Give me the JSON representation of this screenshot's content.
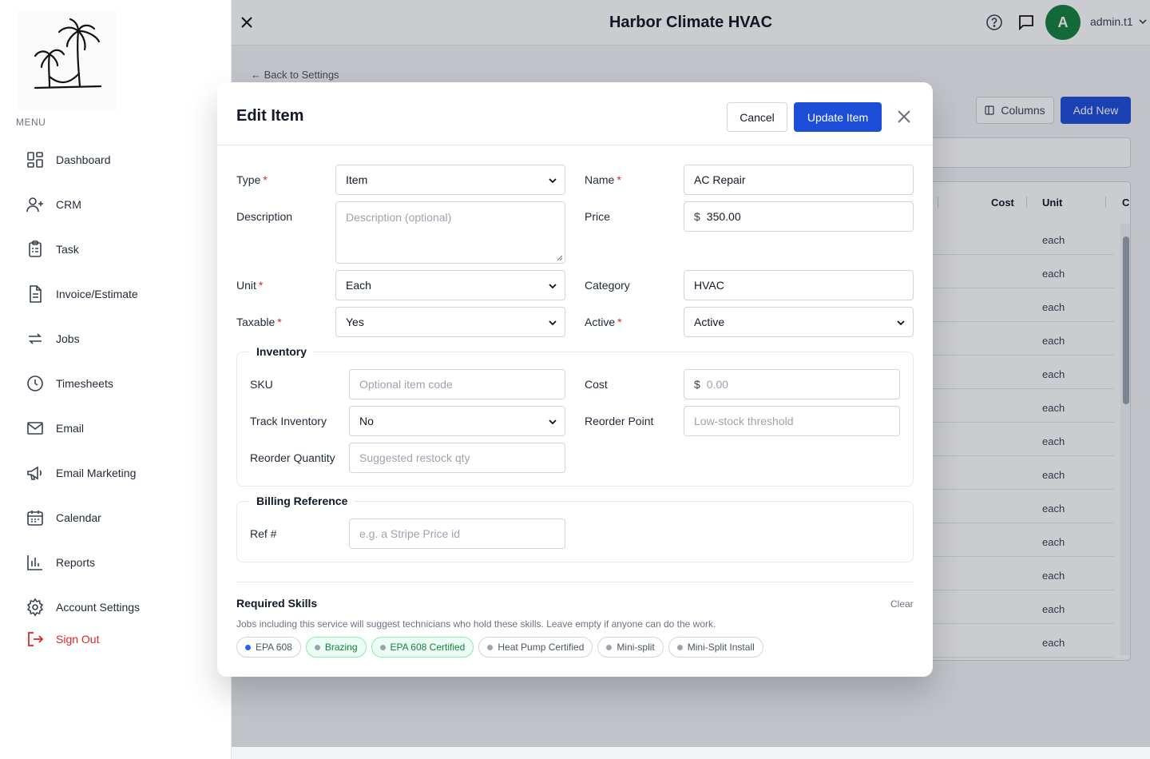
{
  "sidebar": {
    "menu_label": "MENU",
    "items": [
      {
        "label": "Dashboard",
        "icon": "dashboard-icon"
      },
      {
        "label": "CRM",
        "icon": "user-plus-icon"
      },
      {
        "label": "Task",
        "icon": "clipboard-icon"
      },
      {
        "label": "Invoice/Estimate",
        "icon": "document-icon"
      },
      {
        "label": "Jobs",
        "icon": "repeat-icon"
      },
      {
        "label": "Timesheets",
        "icon": "clock-icon"
      },
      {
        "label": "Email",
        "icon": "mail-icon"
      },
      {
        "label": "Email Marketing",
        "icon": "megaphone-icon"
      },
      {
        "label": "Calendar",
        "icon": "calendar-icon"
      },
      {
        "label": "Reports",
        "icon": "bar-chart-icon"
      },
      {
        "label": "Account Settings",
        "icon": "gear-icon"
      }
    ],
    "sign_out": "Sign Out"
  },
  "header": {
    "title": "Harbor Climate HVAC",
    "avatar_initial": "A",
    "user_name": "admin.t1"
  },
  "page": {
    "back_link": "← Back to Settings",
    "columns_button": "Columns",
    "add_new_button": "Add New",
    "table_headers": [
      "Cost",
      "Unit",
      "C"
    ],
    "unit_values": [
      "each",
      "each",
      "each",
      "each",
      "each",
      "each",
      "each",
      "each",
      "each",
      "each",
      "each",
      "each",
      "each"
    ]
  },
  "modal": {
    "title": "Edit Item",
    "cancel": "Cancel",
    "update": "Update Item",
    "fields": {
      "type": {
        "label": "Type",
        "value": "Item"
      },
      "name": {
        "label": "Name",
        "value": "AC Repair"
      },
      "description": {
        "label": "Description",
        "placeholder": "Description (optional)"
      },
      "price": {
        "label": "Price",
        "currency": "$",
        "value": "350.00"
      },
      "unit": {
        "label": "Unit",
        "value": "Each"
      },
      "category": {
        "label": "Category",
        "value": "HVAC"
      },
      "taxable": {
        "label": "Taxable",
        "value": "Yes"
      },
      "active": {
        "label": "Active",
        "value": "Active"
      }
    },
    "inventory": {
      "legend": "Inventory",
      "sku": {
        "label": "SKU",
        "placeholder": "Optional item code"
      },
      "cost": {
        "label": "Cost",
        "currency": "$",
        "placeholder": "0.00"
      },
      "track_inventory": {
        "label": "Track Inventory",
        "value": "No"
      },
      "reorder_point": {
        "label": "Reorder Point",
        "placeholder": "Low-stock threshold"
      },
      "reorder_quantity": {
        "label": "Reorder Quantity",
        "placeholder": "Suggested restock qty"
      }
    },
    "billing": {
      "legend": "Billing Reference",
      "ref": {
        "label": "Ref #",
        "placeholder": "e.g. a Stripe Price id"
      }
    },
    "skills": {
      "title": "Required Skills",
      "clear": "Clear",
      "help": "Jobs including this service will suggest technicians who hold these skills. Leave empty if anyone can do the work.",
      "chips": [
        {
          "label": "EPA 608",
          "state": "blue"
        },
        {
          "label": "Brazing",
          "state": "selected"
        },
        {
          "label": "EPA 608 Certified",
          "state": "selected"
        },
        {
          "label": "Heat Pump Certified",
          "state": "default"
        },
        {
          "label": "Mini-split",
          "state": "default"
        },
        {
          "label": "Mini-Split Install",
          "state": "default"
        }
      ]
    }
  },
  "colors": {
    "primary": "#1d4ed8",
    "avatar": "#15803d",
    "danger": "#dc2626",
    "chip_selected_bg": "#ecfdf5",
    "chip_selected_border": "#86efac"
  }
}
